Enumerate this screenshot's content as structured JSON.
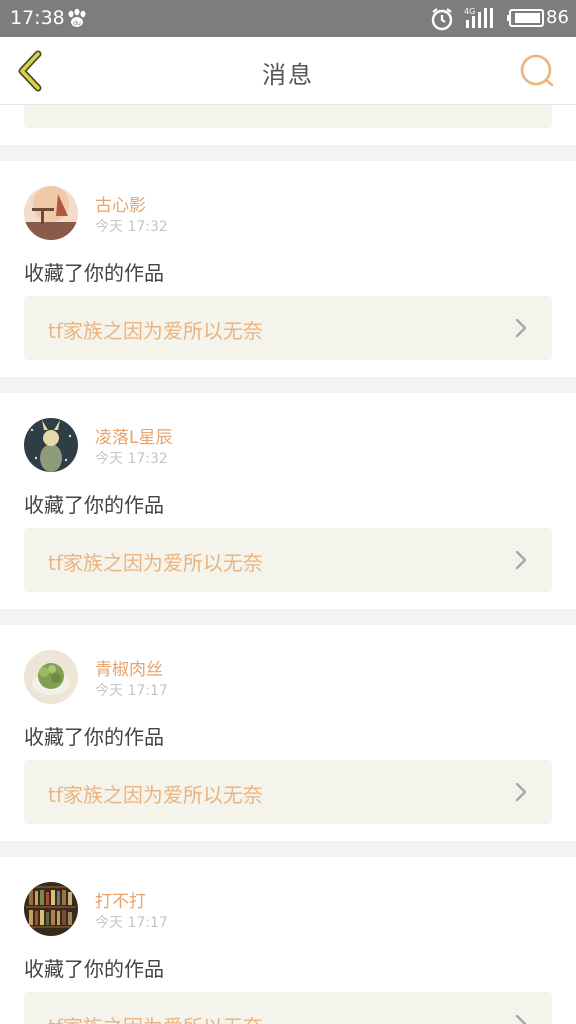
{
  "status_bar": {
    "time": "17:38",
    "network_label": "4G",
    "battery_level": "86"
  },
  "header": {
    "title": "消息",
    "back_icon": "chevron-left-icon",
    "search_icon": "search-icon"
  },
  "colors": {
    "accent_name": "#e7a36b",
    "link_text": "#e9b47f",
    "link_bg": "#f5f4ec",
    "back_icon": "#bdbd2a"
  },
  "notifications": [
    {
      "user": "古心影",
      "time": "今天  17:32",
      "action": "收藏了你的作品",
      "work_title": "tf家族之因为爱所以无奈"
    },
    {
      "user": "凌落L星辰",
      "time": "今天  17:32",
      "action": "收藏了你的作品",
      "work_title": "tf家族之因为爱所以无奈"
    },
    {
      "user": "青椒肉丝",
      "time": "今天  17:17",
      "action": "收藏了你的作品",
      "work_title": "tf家族之因为爱所以无奈"
    },
    {
      "user": "打不打",
      "time": "今天  17:17",
      "action": "收藏了你的作品",
      "work_title": "tf家族之因为爱所以无奈"
    }
  ]
}
